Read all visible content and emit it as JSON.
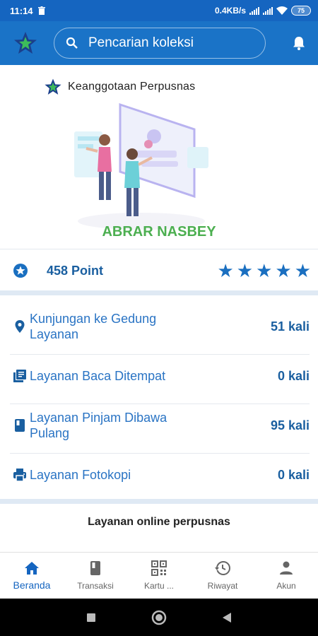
{
  "status_bar": {
    "time": "11:14",
    "network_speed": "0.4KB/s",
    "battery": "75"
  },
  "app_bar": {
    "search_placeholder": "Pencarian koleksi",
    "logo_icon": "star-logo-icon",
    "bell_icon": "bell-icon"
  },
  "hero": {
    "brand": "Keanggotaan Perpusnas",
    "member_name": "ABRAR NASBEY"
  },
  "points": {
    "label": "458 Point",
    "stars": 5
  },
  "services": [
    {
      "icon": "location-pin-icon",
      "label": "Kunjungan ke Gedung Layanan",
      "count": "51 kali"
    },
    {
      "icon": "library-books-icon",
      "label": "Layanan Baca Ditempat",
      "count": "0 kali"
    },
    {
      "icon": "book-icon",
      "label": "Layanan Pinjam Dibawa Pulang",
      "count": "95 kali"
    },
    {
      "icon": "printer-icon",
      "label": "Layanan Fotokopi",
      "count": "0 kali"
    }
  ],
  "online_section": {
    "title": "Layanan online perpusnas"
  },
  "bottom_nav": [
    {
      "icon": "home-icon",
      "label": "Beranda",
      "active": true
    },
    {
      "icon": "book-icon",
      "label": "Transaksi",
      "active": false
    },
    {
      "icon": "qr-code-icon",
      "label": "Kartu ...",
      "active": false
    },
    {
      "icon": "history-icon",
      "label": "Riwayat",
      "active": false
    },
    {
      "icon": "person-icon",
      "label": "Akun",
      "active": false
    }
  ],
  "colors": {
    "primary": "#1a73c7",
    "status_bar": "#1565c0",
    "member_name": "#4caf50",
    "service_text": "#2a74c4"
  }
}
